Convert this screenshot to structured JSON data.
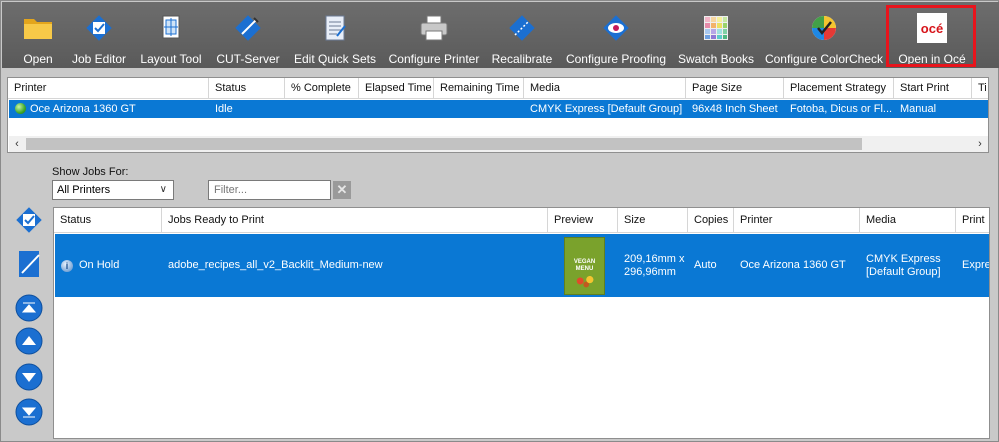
{
  "toolbar": {
    "items": [
      {
        "label": "Open",
        "icon": "folder-icon"
      },
      {
        "label": "Job Editor",
        "icon": "job-editor-icon"
      },
      {
        "label": "Layout Tool",
        "icon": "layout-tool-icon"
      },
      {
        "label": "CUT-Server",
        "icon": "cut-server-icon"
      },
      {
        "label": "Edit Quick Sets",
        "icon": "quick-sets-icon"
      },
      {
        "label": "Configure Printer",
        "icon": "printer-icon"
      },
      {
        "label": "Recalibrate",
        "icon": "recalibrate-icon"
      },
      {
        "label": "Configure Proofing",
        "icon": "proofing-eye-icon"
      },
      {
        "label": "Swatch Books",
        "icon": "swatch-grid-icon"
      },
      {
        "label": "Configure ColorCheck",
        "icon": "color-check-icon"
      },
      {
        "label": "Open in Océ",
        "icon": "oce-logo-icon",
        "logo_text": "océ"
      }
    ],
    "highlight_color": "#e8141c"
  },
  "printers": {
    "columns": [
      "Printer",
      "Status",
      "% Complete",
      "Elapsed Time",
      "Remaining Time",
      "Media",
      "Page Size",
      "Placement Strategy",
      "Start Print",
      "Ti"
    ],
    "rows": [
      {
        "printer": "Oce Arizona 1360 GT",
        "status": "Idle",
        "complete": "",
        "elapsed": "",
        "remaining": "",
        "media": "CMYK Express [Default Group]",
        "page_size": "96x48 Inch Sheet",
        "placement": "Fotoba, Dicus or Fl...",
        "start_print": "Manual",
        "ti": ""
      }
    ],
    "selected_color": "#0a78d4"
  },
  "filters": {
    "show_jobs_label": "Show Jobs For:",
    "show_jobs_value": "All Printers",
    "filter_placeholder": "Filter..."
  },
  "jobs": {
    "columns": [
      "Status",
      "Jobs Ready to Print",
      "Preview",
      "Size",
      "Copies",
      "Printer",
      "Media",
      "Print"
    ],
    "rows": [
      {
        "status": "On Hold",
        "name": "adobe_recipes_all_v2_Backlit_Medium-new",
        "size_line1": "209,16mm x",
        "size_line2": "296,96mm",
        "copies": "Auto",
        "printer": "Oce Arizona 1360 GT",
        "media_line1": "CMYK Express",
        "media_line2": "[Default Group]",
        "print": "Expre",
        "preview_title": "VEGAN",
        "preview_sub": "MENU"
      }
    ]
  }
}
